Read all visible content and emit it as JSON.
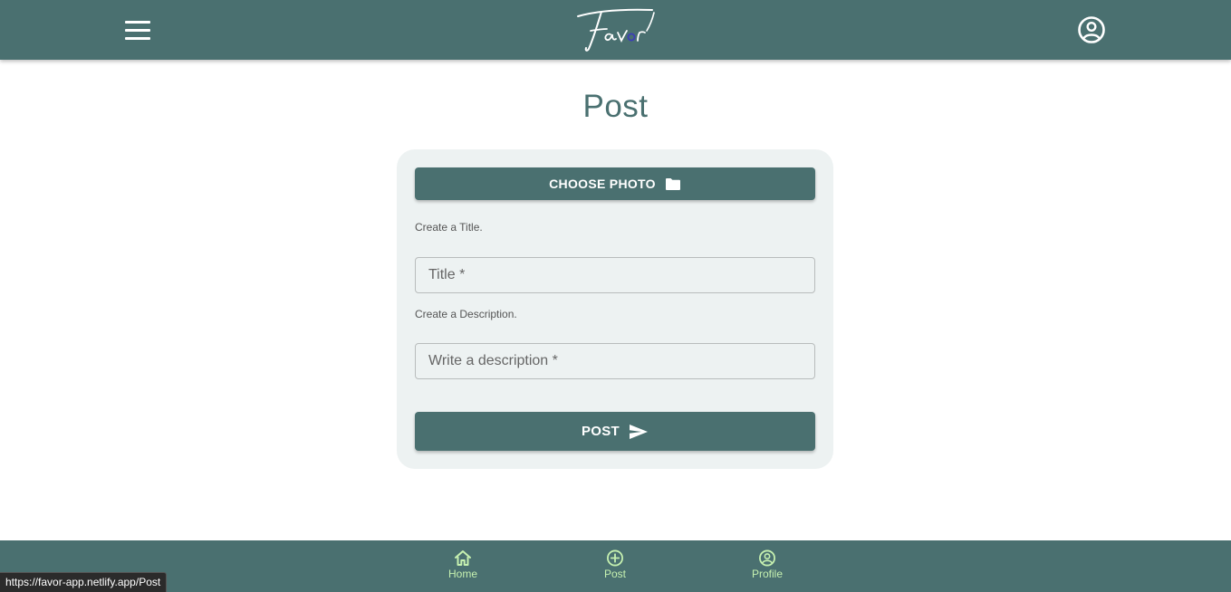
{
  "header": {
    "menu_icon": "menu-icon",
    "logo_text": "Favor",
    "account_icon": "account-circle-icon"
  },
  "page": {
    "title": "Post"
  },
  "form": {
    "choose_photo_label": "CHOOSE PHOTO",
    "choose_photo_icon": "folder-icon",
    "title_helper": "Create a Title.",
    "title_placeholder": "Title *",
    "title_value": "",
    "description_helper": "Create a Description.",
    "description_placeholder": "Write a description *",
    "description_value": "",
    "post_label": "POST",
    "post_icon": "send-icon"
  },
  "bottom_nav": {
    "items": [
      {
        "label": "Home",
        "icon": "home-icon"
      },
      {
        "label": "Post",
        "icon": "add-circle-icon"
      },
      {
        "label": "Profile",
        "icon": "account-circle-icon"
      }
    ]
  },
  "status_bar": {
    "url": "https://favor-app.netlify.app/Post"
  },
  "colors": {
    "primary": "#4a7070",
    "card_bg": "#edf2f2",
    "nav_accent": "#c6f1b0"
  }
}
